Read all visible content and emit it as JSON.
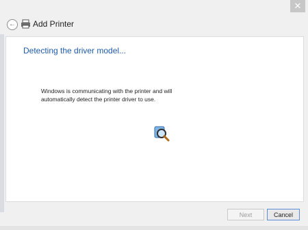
{
  "window": {
    "title": "Add Printer",
    "close_label": "✕"
  },
  "header": {
    "back_icon": "back-arrow-icon",
    "printer_icon": "printer-icon"
  },
  "content": {
    "heading": "Detecting the driver model...",
    "message": "Windows is communicating with the printer and will automatically detect the printer driver to use.",
    "status_icon": "magnifier-search-icon"
  },
  "footer": {
    "next_label": "Next",
    "cancel_label": "Cancel"
  },
  "colors": {
    "heading": "#1e5aa9",
    "accent_border": "#5a8fd6"
  }
}
